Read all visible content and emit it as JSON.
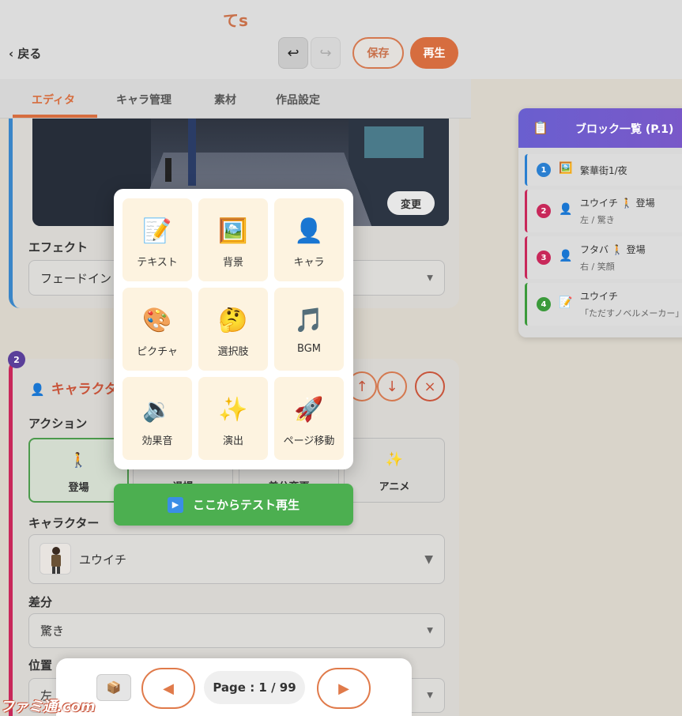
{
  "header": {
    "title": "てs",
    "back_label": "‹ 戻る",
    "undo_icon": "↩",
    "redo_icon": "↪",
    "save_label": "保存",
    "play_label": "再生"
  },
  "tabs": [
    {
      "label": "エディタ",
      "active": true
    },
    {
      "label": "キャラ管理"
    },
    {
      "label": "素材"
    },
    {
      "label": "作品設定"
    }
  ],
  "block1": {
    "change_label": "変更",
    "effect_label": "エフェクト",
    "effect_value": "フェードイン"
  },
  "block2": {
    "number": "2",
    "title": "キャラクタ",
    "up_icon": "↑",
    "down_icon": "↓",
    "delete_icon": "×",
    "action_label": "アクション",
    "actions": [
      {
        "label": "登場",
        "icon": "🚶",
        "active": true
      },
      {
        "label": "退場"
      },
      {
        "label": "差分変更"
      },
      {
        "label": "アニメ",
        "icon": "✨"
      }
    ],
    "character_label": "キャラクター",
    "character_value": "ユウイチ",
    "variant_label": "差分",
    "variant_value": "驚き",
    "position_label": "位置",
    "position_value": "左"
  },
  "picker": {
    "items": [
      {
        "label": "テキスト",
        "icon": "📝"
      },
      {
        "label": "背景",
        "icon": "🖼️"
      },
      {
        "label": "キャラ",
        "icon": "👤"
      },
      {
        "label": "ピクチャ",
        "icon": "🎨"
      },
      {
        "label": "選択肢",
        "icon": "🤔"
      },
      {
        "label": "BGM",
        "icon": "🎵"
      },
      {
        "label": "効果音",
        "icon": "🔉"
      },
      {
        "label": "演出",
        "icon": "✨"
      },
      {
        "label": "ページ移動",
        "icon": "🚀"
      }
    ],
    "test_play_label": "ここからテスト再生",
    "test_play_icon": "▶"
  },
  "block_list": {
    "title": "ブロック一覧 (P.1)",
    "icon": "📋",
    "items": [
      {
        "num": "1",
        "color": "#2a7fd0",
        "icon": "🖼️",
        "line1": "繁華街1/夜",
        "line2": ""
      },
      {
        "num": "2",
        "color": "#c8285a",
        "icon": "👤",
        "line1": "ユウイチ 🚶 登場",
        "line2": "左 / 驚き"
      },
      {
        "num": "3",
        "color": "#c8285a",
        "icon": "👤",
        "line1": "フタバ 🚶 登場",
        "line2": "右 / 笑顔"
      },
      {
        "num": "4",
        "color": "#3a9a3a",
        "icon": "📝",
        "line1": "ユウイチ",
        "line2": "「ただすノベルメーカー」"
      }
    ]
  },
  "pager": {
    "box_icon": "📦",
    "prev_icon": "◀",
    "next_icon": "▶",
    "page_text": "Page : 1 / 99"
  },
  "watermark": "ファミ通.com",
  "colors": {
    "accent": "#d66d3f",
    "green": "#4caf50",
    "purple": "#6a5fcf"
  }
}
